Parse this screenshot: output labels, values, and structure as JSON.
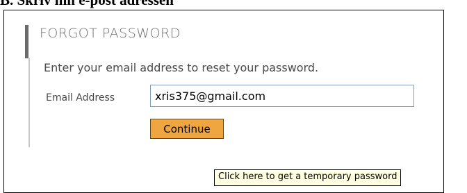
{
  "caption": "B. Skriv inn e-post adressen",
  "form": {
    "title": "FORGOT PASSWORD",
    "instruction": "Enter your email address to reset your password.",
    "email_label": "Email Address",
    "email_value": "xris375@gmail.com",
    "continue_label": "Continue",
    "tooltip": "Click here to get a temporary password"
  },
  "colors": {
    "button_background": "#f0a640",
    "tooltip_background": "#ffffe1",
    "accent_bar": "#6b6b6b"
  }
}
